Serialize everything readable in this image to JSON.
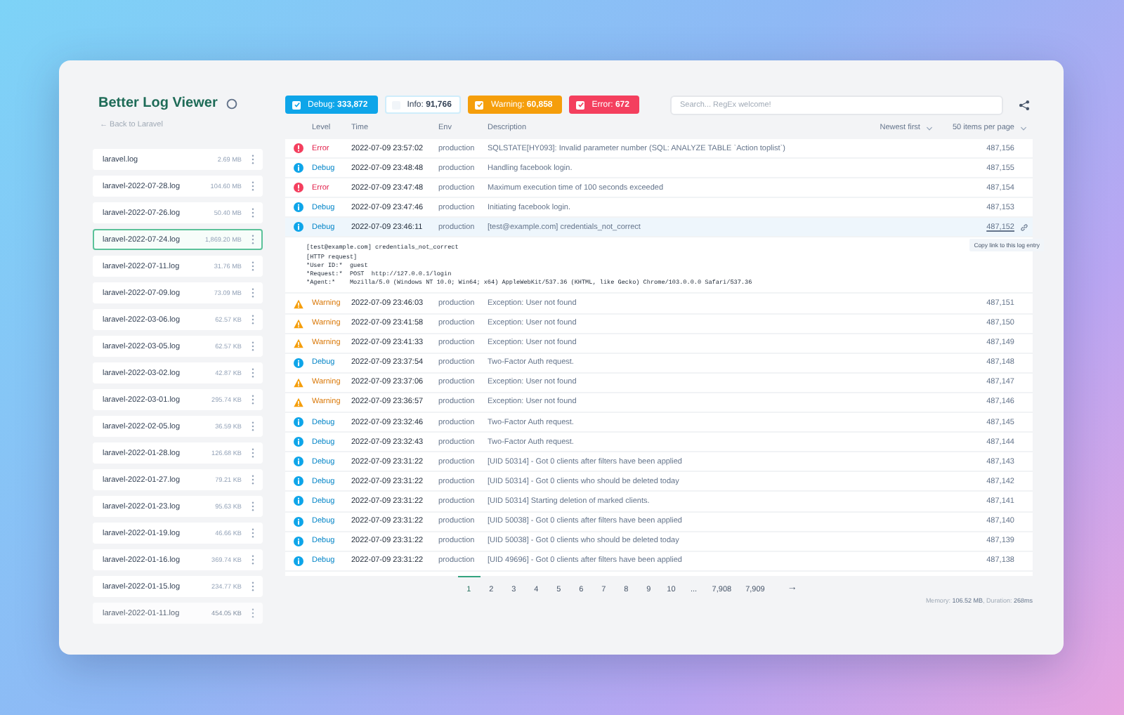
{
  "app": {
    "title": "Better Log Viewer",
    "back_link": "← Back to Laravel"
  },
  "files": [
    {
      "name": "laravel.log",
      "size": "2.69 MB",
      "selected": false
    },
    {
      "name": "laravel-2022-07-28.log",
      "size": "104.60 MB",
      "selected": false
    },
    {
      "name": "laravel-2022-07-26.log",
      "size": "50.40 MB",
      "selected": false
    },
    {
      "name": "laravel-2022-07-24.log",
      "size": "1,869.20 MB",
      "selected": true
    },
    {
      "name": "laravel-2022-07-11.log",
      "size": "31.76 MB",
      "selected": false
    },
    {
      "name": "laravel-2022-07-09.log",
      "size": "73.09 MB",
      "selected": false
    },
    {
      "name": "laravel-2022-03-06.log",
      "size": "62.57 KB",
      "selected": false
    },
    {
      "name": "laravel-2022-03-05.log",
      "size": "62.57 KB",
      "selected": false
    },
    {
      "name": "laravel-2022-03-02.log",
      "size": "42.87 KB",
      "selected": false
    },
    {
      "name": "laravel-2022-03-01.log",
      "size": "295.74 KB",
      "selected": false
    },
    {
      "name": "laravel-2022-02-05.log",
      "size": "36.59 KB",
      "selected": false
    },
    {
      "name": "laravel-2022-01-28.log",
      "size": "126.68 KB",
      "selected": false
    },
    {
      "name": "laravel-2022-01-27.log",
      "size": "79.21 KB",
      "selected": false
    },
    {
      "name": "laravel-2022-01-23.log",
      "size": "95.63 KB",
      "selected": false
    },
    {
      "name": "laravel-2022-01-19.log",
      "size": "46.66 KB",
      "selected": false
    },
    {
      "name": "laravel-2022-01-16.log",
      "size": "369.74 KB",
      "selected": false
    },
    {
      "name": "laravel-2022-01-15.log",
      "size": "234.77 KB",
      "selected": false
    },
    {
      "name": "laravel-2022-01-11.log",
      "size": "454.05 KB",
      "selected": false
    }
  ],
  "filters": [
    {
      "kind": "debug",
      "label": "Debug:",
      "count": "333,872",
      "checked": true
    },
    {
      "kind": "info",
      "label": "Info:",
      "count": "91,766",
      "checked": false
    },
    {
      "kind": "warning",
      "label": "Warning:",
      "count": "60,858",
      "checked": true
    },
    {
      "kind": "error",
      "label": "Error:",
      "count": "672",
      "checked": true
    }
  ],
  "search": {
    "placeholder": "Search... RegEx welcome!"
  },
  "table": {
    "columns": [
      "Level",
      "Time",
      "Env",
      "Description"
    ],
    "sort": "Newest first",
    "per_page": "50 items per page",
    "rows": [
      {
        "kind": "error",
        "level": "Error",
        "time": "2022-07-09 23:57:02",
        "env": "production",
        "description": "SQLSTATE[HY093]: Invalid parameter number (SQL: ANALYZE TABLE `Action toplist`)",
        "index": "487,156",
        "selected": false
      },
      {
        "kind": "debug",
        "level": "Debug",
        "time": "2022-07-09 23:48:48",
        "env": "production",
        "description": "Handling facebook login.",
        "index": "487,155",
        "selected": false
      },
      {
        "kind": "error",
        "level": "Error",
        "time": "2022-07-09 23:47:48",
        "env": "production",
        "description": "Maximum execution time of 100 seconds exceeded",
        "index": "487,154",
        "selected": false
      },
      {
        "kind": "debug",
        "level": "Debug",
        "time": "2022-07-09 23:47:46",
        "env": "production",
        "description": "Initiating facebook login.",
        "index": "487,153",
        "selected": false
      },
      {
        "kind": "debug",
        "level": "Debug",
        "time": "2022-07-09 23:46:11",
        "env": "production",
        "description": "[test@example.com] credentials_not_correct",
        "index": "487,152",
        "selected": true,
        "details": "[test@example.com] credentials_not_correct\n[HTTP request]\n*User ID:*  guest\n*Request:*  POST  http://127.0.0.1/login\n*Agent:*    Mozilla/5.0 (Windows NT 10.0; Win64; x64) AppleWebKit/537.36 (KHTML, like Gecko) Chrome/103.0.0.0 Safari/537.36",
        "tooltip": "Copy link to this log entry"
      },
      {
        "kind": "warning",
        "level": "Warning",
        "time": "2022-07-09 23:46:03",
        "env": "production",
        "description": "Exception: User not found",
        "index": "487,151",
        "selected": false
      },
      {
        "kind": "warning",
        "level": "Warning",
        "time": "2022-07-09 23:41:58",
        "env": "production",
        "description": "Exception: User not found",
        "index": "487,150",
        "selected": false
      },
      {
        "kind": "warning",
        "level": "Warning",
        "time": "2022-07-09 23:41:33",
        "env": "production",
        "description": "Exception: User not found",
        "index": "487,149",
        "selected": false
      },
      {
        "kind": "debug",
        "level": "Debug",
        "time": "2022-07-09 23:37:54",
        "env": "production",
        "description": "Two-Factor Auth request.",
        "index": "487,148",
        "selected": false
      },
      {
        "kind": "warning",
        "level": "Warning",
        "time": "2022-07-09 23:37:06",
        "env": "production",
        "description": "Exception: User not found",
        "index": "487,147",
        "selected": false
      },
      {
        "kind": "warning",
        "level": "Warning",
        "time": "2022-07-09 23:36:57",
        "env": "production",
        "description": "Exception: User not found",
        "index": "487,146",
        "selected": false
      },
      {
        "kind": "debug",
        "level": "Debug",
        "time": "2022-07-09 23:32:46",
        "env": "production",
        "description": "Two-Factor Auth request.",
        "index": "487,145",
        "selected": false
      },
      {
        "kind": "debug",
        "level": "Debug",
        "time": "2022-07-09 23:32:43",
        "env": "production",
        "description": "Two-Factor Auth request.",
        "index": "487,144",
        "selected": false
      },
      {
        "kind": "debug",
        "level": "Debug",
        "time": "2022-07-09 23:31:22",
        "env": "production",
        "description": "[UID 50314] - Got 0 clients after filters have been applied",
        "index": "487,143",
        "selected": false
      },
      {
        "kind": "debug",
        "level": "Debug",
        "time": "2022-07-09 23:31:22",
        "env": "production",
        "description": "[UID 50314] - Got 0 clients who should be deleted today",
        "index": "487,142",
        "selected": false
      },
      {
        "kind": "debug",
        "level": "Debug",
        "time": "2022-07-09 23:31:22",
        "env": "production",
        "description": "[UID 50314] Starting deletion of marked clients.",
        "index": "487,141",
        "selected": false
      },
      {
        "kind": "debug",
        "level": "Debug",
        "time": "2022-07-09 23:31:22",
        "env": "production",
        "description": "[UID 50038] - Got 0 clients after filters have been applied",
        "index": "487,140",
        "selected": false
      },
      {
        "kind": "debug",
        "level": "Debug",
        "time": "2022-07-09 23:31:22",
        "env": "production",
        "description": "[UID 50038] - Got 0 clients who should be deleted today",
        "index": "487,139",
        "selected": false
      },
      {
        "kind": "debug",
        "level": "Debug",
        "time": "2022-07-09 23:31:22",
        "env": "production",
        "description": "[UID 49696] - Got 0 clients after filters have been applied",
        "index": "487,138",
        "selected": false
      }
    ]
  },
  "pagination": {
    "pages": [
      {
        "label": "1",
        "selected": true
      },
      {
        "label": "2",
        "selected": false
      },
      {
        "label": "3",
        "selected": false
      },
      {
        "label": "4",
        "selected": false
      },
      {
        "label": "5",
        "selected": false
      },
      {
        "label": "6",
        "selected": false
      },
      {
        "label": "7",
        "selected": false
      },
      {
        "label": "8",
        "selected": false
      },
      {
        "label": "9",
        "selected": false
      },
      {
        "label": "10",
        "selected": false
      },
      {
        "label": "...",
        "selected": false
      },
      {
        "label": "7,908",
        "selected": false
      },
      {
        "label": "7,909",
        "selected": false
      }
    ],
    "next": "→"
  },
  "footer": {
    "stats": "Memory: **106.52 MB**, Duration: **268ms**"
  }
}
